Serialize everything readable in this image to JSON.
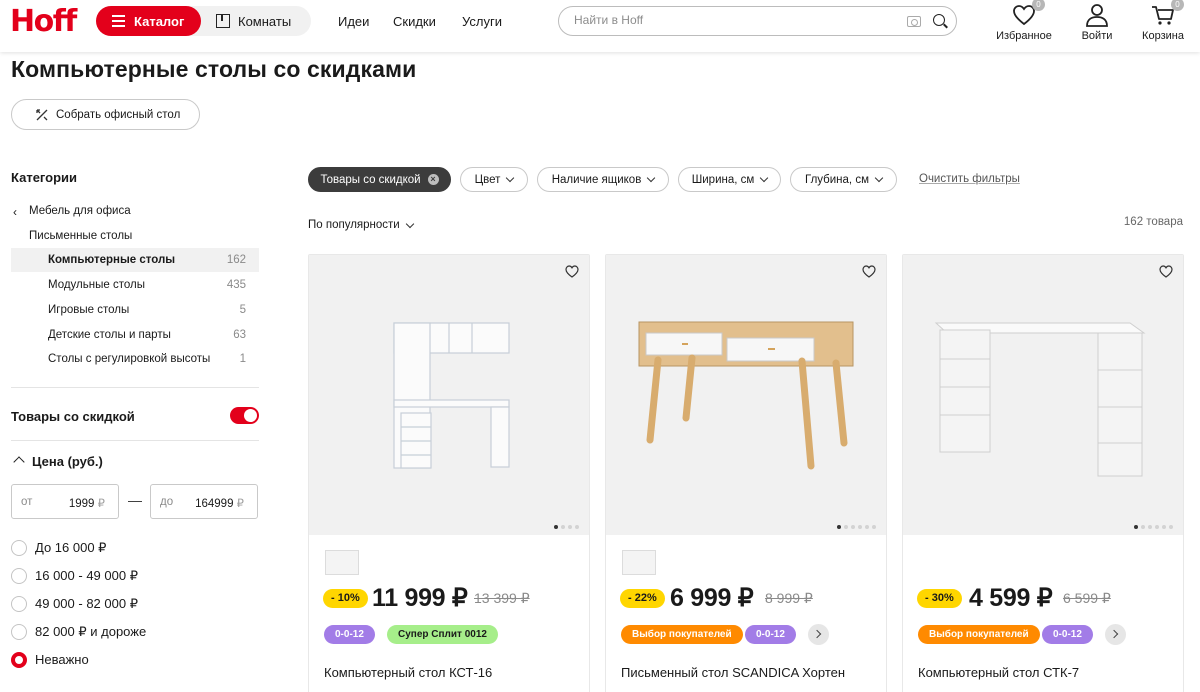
{
  "header": {
    "logo": "Hoff",
    "catalog_label": "Каталог",
    "rooms_label": "Комнаты",
    "nav": [
      "Идеи",
      "Скидки",
      "Услуги"
    ],
    "search_placeholder": "Найти в Hoff",
    "favorites": {
      "label": "Избранное",
      "count": "0"
    },
    "login": {
      "label": "Войти"
    },
    "cart": {
      "label": "Корзина",
      "count": "0"
    }
  },
  "page": {
    "title": "Компьютерные столы со скидками",
    "office_button": "Собрать офисный стол"
  },
  "sidebar": {
    "categories_heading": "Категории",
    "parent": "Мебель для офиса",
    "subparent": "Письменные столы",
    "items": [
      {
        "label": "Компьютерные столы",
        "count": "162",
        "active": true
      },
      {
        "label": "Модульные столы",
        "count": "435"
      },
      {
        "label": "Игровые столы",
        "count": "5"
      },
      {
        "label": "Детские столы и парты",
        "count": "63"
      },
      {
        "label": "Столы с регулировкой высоты",
        "count": "1"
      }
    ],
    "discount_toggle_label": "Товары со скидкой",
    "discount_toggle_on": true,
    "price": {
      "heading": "Цена (руб.)",
      "from_prefix": "от",
      "from_value": "1999",
      "to_prefix": "до",
      "to_value": "164999",
      "currency": "₽",
      "dash": "—",
      "options": [
        "До 16 000 ₽",
        "16 000 - 49 000 ₽",
        "49 000 - 82 000 ₽",
        "82 000 ₽ и дороже",
        "Неважно"
      ],
      "selected": "Неважно"
    }
  },
  "filters": {
    "active_chip": "Товары со скидкой",
    "chips": [
      "Цвет",
      "Наличие ящиков",
      "Ширина, см",
      "Глубина, см"
    ],
    "clear_label": "Очистить фильтры",
    "sort_label": "По популярности",
    "count_label": "162 товара"
  },
  "colors": {
    "brand": "#e3001b",
    "discount_badge": "#ffd600",
    "tag_purple": "#a27ce7",
    "tag_green": "#a6ee8a",
    "tag_orange": "#ff8a00"
  },
  "products": [
    {
      "name": "Компьютерный стол КСТ-16",
      "discount": "- 10%",
      "price": "11 999 ₽",
      "old_price": "13 399 ₽",
      "tags": [
        "0-0-12",
        "Супер Сплит 0012"
      ]
    },
    {
      "name": "Письменный стол SCANDICA Хортен",
      "discount": "- 22%",
      "price": "6 999 ₽",
      "old_price": "8 999 ₽",
      "tags": [
        "Выбор покупателей",
        "0-0-12"
      ]
    },
    {
      "name": "Компьютерный стол СТК-7",
      "discount": "- 30%",
      "price": "4 599 ₽",
      "old_price": "6 599 ₽",
      "tags": [
        "Выбор покупателей",
        "0-0-12"
      ]
    }
  ]
}
